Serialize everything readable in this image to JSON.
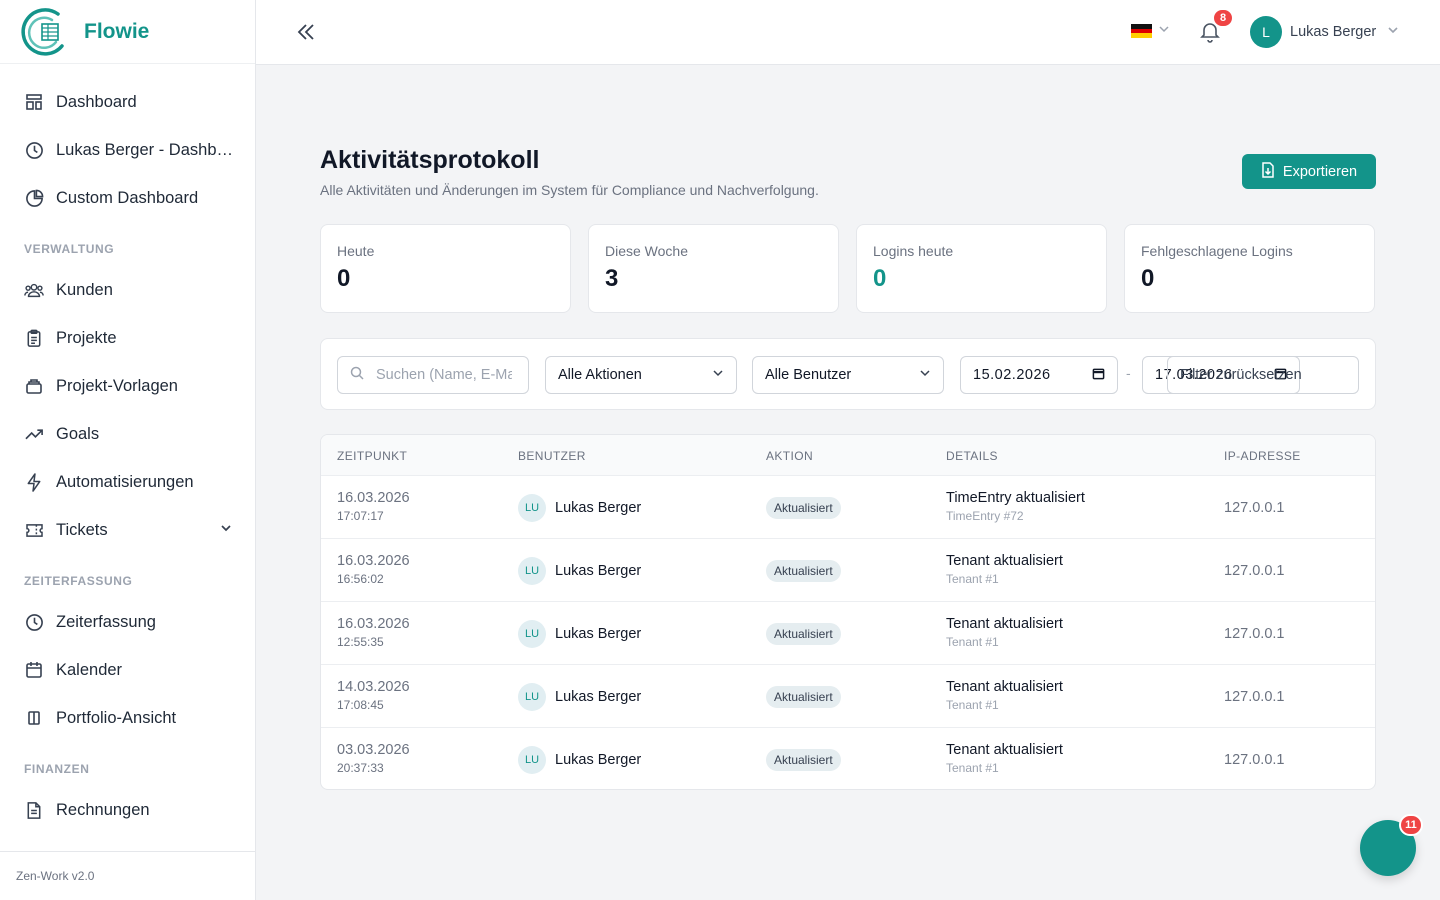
{
  "app": {
    "name": "Flowie",
    "version": "Zen-Work v2.0"
  },
  "sidebar": {
    "items_top": [
      {
        "label": "Dashboard",
        "icon": "dashboard-icon"
      },
      {
        "label": "Lukas Berger - Dashboard",
        "icon": "clock-icon"
      },
      {
        "label": "Custom Dashboard",
        "icon": "pie-chart-icon"
      }
    ],
    "sections": [
      {
        "title": "VERWALTUNG",
        "items": [
          {
            "label": "Kunden",
            "icon": "users-icon"
          },
          {
            "label": "Projekte",
            "icon": "clipboard-icon"
          },
          {
            "label": "Projekt-Vorlagen",
            "icon": "template-icon"
          },
          {
            "label": "Goals",
            "icon": "trend-icon"
          },
          {
            "label": "Automatisierungen",
            "icon": "lightning-icon"
          },
          {
            "label": "Tickets",
            "icon": "ticket-icon"
          }
        ]
      },
      {
        "title": "ZEITERFASSUNG",
        "items": [
          {
            "label": "Zeiterfassung",
            "icon": "clock-icon"
          },
          {
            "label": "Kalender",
            "icon": "calendar-icon"
          },
          {
            "label": "Portfolio-Ansicht",
            "icon": "columns-icon"
          }
        ]
      },
      {
        "title": "FINANZEN",
        "items": [
          {
            "label": "Rechnungen",
            "icon": "document-icon"
          }
        ]
      }
    ]
  },
  "header": {
    "notifications_count": "8",
    "user_initial": "L",
    "user_name": "Lukas Berger",
    "language": "de"
  },
  "page": {
    "title": "Aktivitätsprotokoll",
    "subtitle": "Alle Aktivitäten und Änderungen im System für Compliance und Nachverfolgung.",
    "export_label": "Exportieren"
  },
  "stats": [
    {
      "label": "Heute",
      "value": "0"
    },
    {
      "label": "Diese Woche",
      "value": "3"
    },
    {
      "label": "Logins heute",
      "value": "0"
    },
    {
      "label": "Fehlgeschlagene Logins",
      "value": "0"
    }
  ],
  "filters": {
    "search_placeholder": "Suchen (Name, E-Mail...)",
    "action_select": "Alle Aktionen",
    "user_select": "Alle Benutzer",
    "date_from": "15.02.2026",
    "date_to": "17.03.2026",
    "reset_label": "Filter zurücksetzen"
  },
  "table": {
    "headers": [
      "ZEITPUNKT",
      "BENUTZER",
      "AKTION",
      "DETAILS",
      "IP-ADRESSE"
    ],
    "rows": [
      {
        "date": "16.03.2026",
        "time": "17:07:17",
        "initials": "LU",
        "user": "Lukas Berger",
        "action": "Aktualisiert",
        "details": "TimeEntry aktualisiert",
        "sub": "TimeEntry #72",
        "ip": "127.0.0.1"
      },
      {
        "date": "16.03.2026",
        "time": "16:56:02",
        "initials": "LU",
        "user": "Lukas Berger",
        "action": "Aktualisiert",
        "details": "Tenant aktualisiert",
        "sub": "Tenant #1",
        "ip": "127.0.0.1"
      },
      {
        "date": "16.03.2026",
        "time": "12:55:35",
        "initials": "LU",
        "user": "Lukas Berger",
        "action": "Aktualisiert",
        "details": "Tenant aktualisiert",
        "sub": "Tenant #1",
        "ip": "127.0.0.1"
      },
      {
        "date": "14.03.2026",
        "time": "17:08:45",
        "initials": "LU",
        "user": "Lukas Berger",
        "action": "Aktualisiert",
        "details": "Tenant aktualisiert",
        "sub": "Tenant #1",
        "ip": "127.0.0.1"
      },
      {
        "date": "03.03.2026",
        "time": "20:37:33",
        "initials": "LU",
        "user": "Lukas Berger",
        "action": "Aktualisiert",
        "details": "Tenant aktualisiert",
        "sub": "Tenant #1",
        "ip": "127.0.0.1"
      }
    ]
  },
  "fab": {
    "badge": "11"
  },
  "colors": {
    "accent": "#13948a",
    "danger": "#ef4444"
  }
}
